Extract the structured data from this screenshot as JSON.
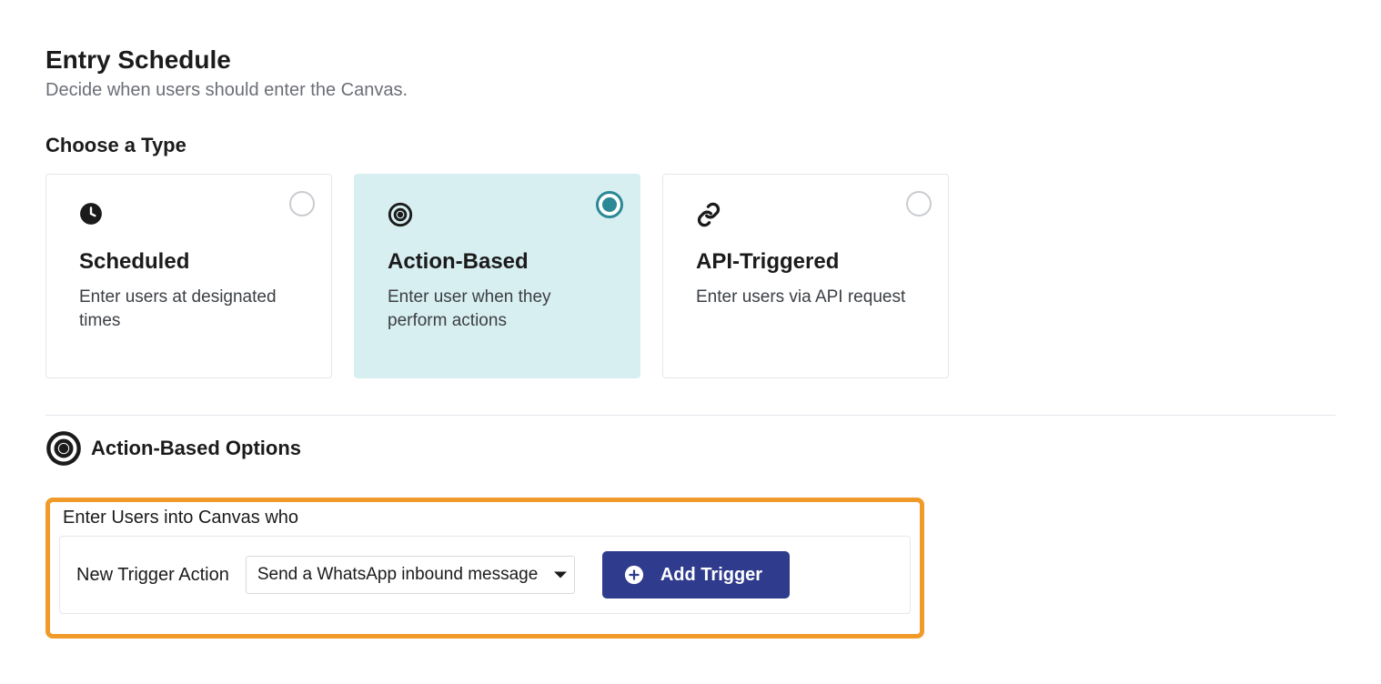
{
  "entrySchedule": {
    "title": "Entry Schedule",
    "subtitle": "Decide when users should enter the Canvas."
  },
  "chooseType": {
    "label": "Choose a Type",
    "cards": [
      {
        "title": "Scheduled",
        "desc": "Enter users at designated times",
        "selected": false,
        "icon": "clock-icon"
      },
      {
        "title": "Action-Based",
        "desc": "Enter user when they perform actions",
        "selected": true,
        "icon": "target-icon"
      },
      {
        "title": "API-Triggered",
        "desc": "Enter users via API request",
        "selected": false,
        "icon": "link-icon"
      }
    ]
  },
  "actionOptions": {
    "headerTitle": "Action-Based Options",
    "enterUsersLabel": "Enter Users into Canvas who",
    "newTriggerLabel": "New Trigger Action",
    "triggerSelectValue": "Send a WhatsApp inbound message",
    "addTriggerLabel": "Add Trigger"
  },
  "colors": {
    "accent": "#2a8994",
    "primaryButton": "#2f3b8c",
    "highlight": "#f09a2a"
  }
}
